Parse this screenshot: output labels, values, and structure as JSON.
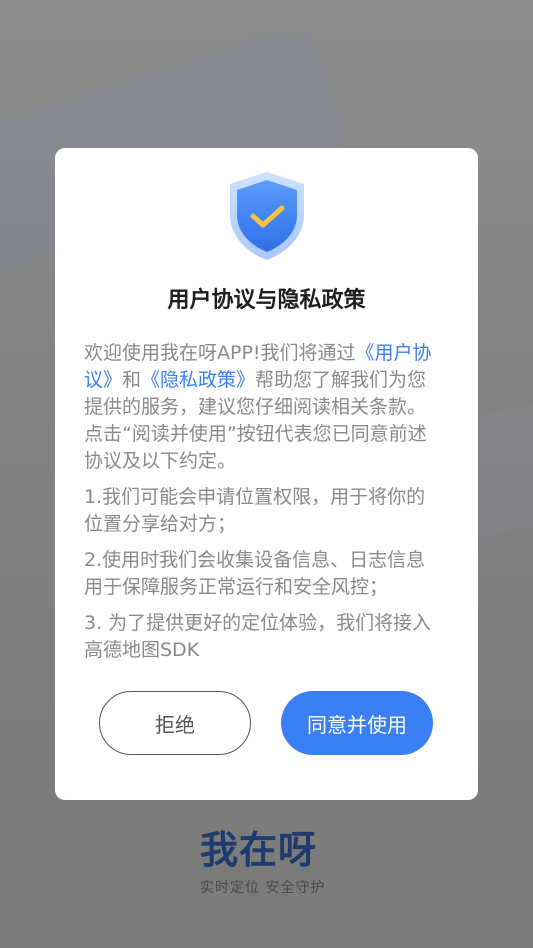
{
  "dialog": {
    "title": "用户协议与隐私政策",
    "intro": {
      "t1": "欢迎使用我在呀APP!我们将通过",
      "link1": "《用户协议》",
      "t2": "和",
      "link2": "《隐私政策》",
      "t3": "帮助您了解我们为您提供的服务，建议您仔细阅读相关条款。点击“阅读并使用”按钮代表您已同意前述协议及以下约定。"
    },
    "items": [
      "1.我们可能会申请位置权限，用于将你的位置分享给对方；",
      "2.使用时我们会收集设备信息、日志信息用于保障服务正常运行和安全风控；",
      "3. 为了提供更好的定位体验，我们将接入高德地图SDK"
    ],
    "decline_label": "拒绝",
    "agree_label": "同意并使用",
    "icon": "shield-check-icon"
  },
  "brand": {
    "name": "我在呀",
    "slogan": "实时定位 安全守护"
  },
  "colors": {
    "accent": "#3a7ff5",
    "brand": "#1f3b6e",
    "text_muted": "#8a8a8a"
  }
}
